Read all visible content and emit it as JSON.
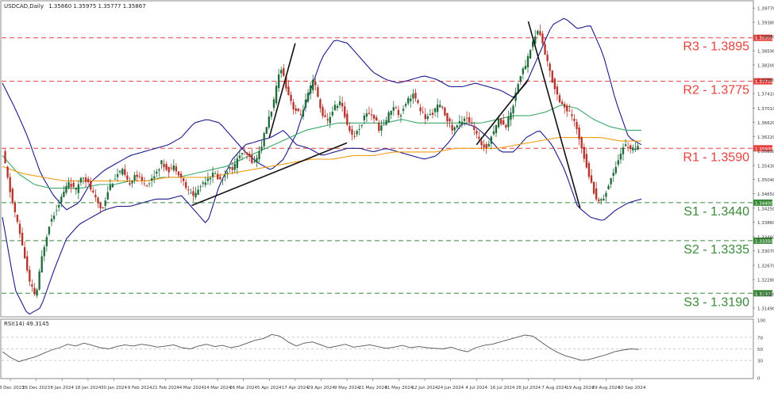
{
  "header": {
    "symbol": "USDCAD,Daily",
    "ohlc": "1.35860 1.35975 1.35777 1.35867"
  },
  "rsi_label": "RSI(14) 49.3145",
  "colors": {
    "resistance": "#e8413c",
    "support": "#3a8a3a",
    "bollinger": "#1a1a8c",
    "ma_green": "#3aa86a",
    "ma_orange": "#f39c12",
    "bull": "#1f6b3a",
    "bear": "#b5332a",
    "rsi": "#555555"
  },
  "levels": [
    {
      "name": "R3",
      "label": "R3 - 1.3895",
      "value": 1.3895,
      "tag": "1.38950",
      "type": "resistance"
    },
    {
      "name": "R2",
      "label": "R2 - 1.3775",
      "value": 1.3775,
      "tag": "1.37750",
      "type": "resistance"
    },
    {
      "name": "R1",
      "label": "R1 - 1.3590",
      "value": 1.359,
      "tag": "1.35900",
      "type": "resistance"
    },
    {
      "name": "S1",
      "label": "S1 - 1.3440",
      "value": 1.344,
      "tag": "1.34400",
      "type": "support"
    },
    {
      "name": "S2",
      "label": "S2 - 1.3335",
      "value": 1.3335,
      "tag": "1.33350",
      "type": "support"
    },
    {
      "name": "S3",
      "label": "S3 - 1.3190",
      "value": 1.319,
      "tag": "1.31900",
      "type": "support"
    }
  ],
  "chart_data": {
    "type": "candlestick",
    "ylim": [
      1.3125,
      1.3995
    ],
    "y_ticks": [
      "1.39770",
      "1.39380",
      "1.38990",
      "1.38590",
      "1.38200",
      "1.37800",
      "1.37410",
      "1.37010",
      "1.36620",
      "1.36220",
      "1.35830",
      "1.35430",
      "1.35040",
      "1.34650",
      "1.34250",
      "1.33860",
      "1.33460",
      "1.33070",
      "1.32670",
      "1.32280",
      "1.31880",
      "1.31490"
    ],
    "x_ticks": [
      "13 Dec 2023",
      "26 Dec 2023",
      "8 Jan 2024",
      "18 Jan 2024",
      "30 Jan 2024",
      "9 Feb 2024",
      "21 Feb 2024",
      "4 Mar 2024",
      "14 Mar 2024",
      "26 Mar 2024",
      "5 Apr 2024",
      "17 Apr 2024",
      "29 Apr 2024",
      "9 May 2024",
      "21 May 2024",
      "31 May 2024",
      "12 Jun 2024",
      "24 Jun 2024",
      "4 Jul 2024",
      "16 Jul 2024",
      "26 Jul 2024",
      "7 Aug 2024",
      "19 Aug 2024",
      "29 Aug 2024",
      "10 Sep 2024"
    ],
    "close_path": [
      1.358,
      1.348,
      1.34,
      1.332,
      1.322,
      1.318,
      1.33,
      1.338,
      1.342,
      1.346,
      1.35,
      1.347,
      1.352,
      1.349,
      1.345,
      1.342,
      1.348,
      1.351,
      1.353,
      1.349,
      1.352,
      1.35,
      1.349,
      1.352,
      1.355,
      1.353,
      1.354,
      1.351,
      1.347,
      1.346,
      1.349,
      1.351,
      1.352,
      1.35,
      1.353,
      1.354,
      1.358,
      1.357,
      1.355,
      1.359,
      1.366,
      1.372,
      1.382,
      1.375,
      1.37,
      1.368,
      1.373,
      1.378,
      1.37,
      1.366,
      1.37,
      1.372,
      1.366,
      1.362,
      1.365,
      1.369,
      1.368,
      1.364,
      1.367,
      1.371,
      1.368,
      1.372,
      1.374,
      1.37,
      1.367,
      1.369,
      1.371,
      1.368,
      1.364,
      1.366,
      1.368,
      1.365,
      1.361,
      1.359,
      1.363,
      1.367,
      1.365,
      1.37,
      1.378,
      1.382,
      1.388,
      1.392,
      1.385,
      1.378,
      1.373,
      1.37,
      1.368,
      1.363,
      1.356,
      1.349,
      1.344,
      1.346,
      1.351,
      1.356,
      1.36,
      1.359,
      1.359
    ],
    "upper_band": [
      1.377,
      1.37,
      1.362,
      1.352,
      1.346,
      1.342,
      1.344,
      1.35,
      1.353,
      1.355,
      1.357,
      1.358,
      1.359,
      1.36,
      1.362,
      1.366,
      1.367,
      1.366,
      1.362,
      1.358,
      1.355,
      1.353,
      1.356,
      1.363,
      1.374,
      1.384,
      1.389,
      1.388,
      1.384,
      1.38,
      1.378,
      1.377,
      1.378,
      1.379,
      1.378,
      1.376,
      1.376,
      1.377,
      1.376,
      1.375,
      1.373,
      1.377,
      1.385,
      1.393,
      1.395,
      1.392,
      1.393,
      1.385,
      1.372,
      1.362,
      1.36
    ],
    "lower_band": [
      1.34,
      1.32,
      1.313,
      1.315,
      1.325,
      1.334,
      1.338,
      1.34,
      1.342,
      1.343,
      1.343,
      1.344,
      1.345,
      1.345,
      1.346,
      1.342,
      1.338,
      1.349,
      1.356,
      1.36,
      1.361,
      1.362,
      1.364,
      1.36,
      1.359,
      1.357,
      1.358,
      1.359,
      1.359,
      1.358,
      1.359,
      1.358,
      1.357,
      1.356,
      1.357,
      1.361,
      1.366,
      1.365,
      1.362,
      1.358,
      1.358,
      1.362,
      1.364,
      1.36,
      1.353,
      1.343,
      1.34,
      1.339,
      1.342,
      1.344,
      1.345
    ],
    "ma_green": [
      1.357,
      1.352,
      1.349,
      1.348,
      1.348,
      1.348,
      1.349,
      1.349,
      1.35,
      1.35,
      1.351,
      1.351,
      1.352,
      1.353,
      1.354,
      1.356,
      1.358,
      1.36,
      1.362,
      1.364,
      1.365,
      1.366,
      1.366,
      1.366,
      1.366,
      1.367,
      1.366,
      1.366,
      1.366,
      1.366,
      1.366,
      1.367,
      1.368,
      1.368,
      1.369,
      1.371,
      1.37,
      1.367,
      1.365,
      1.364,
      1.364
    ],
    "ma_orange": [
      1.354,
      1.352,
      1.351,
      1.35,
      1.35,
      1.35,
      1.35,
      1.35,
      1.351,
      1.351,
      1.351,
      1.352,
      1.353,
      1.354,
      1.355,
      1.356,
      1.356,
      1.357,
      1.357,
      1.358,
      1.358,
      1.358,
      1.359,
      1.359,
      1.359,
      1.36,
      1.361,
      1.362,
      1.362,
      1.362,
      1.361,
      1.361
    ],
    "trendlines": [
      {
        "from": [
          "4 Mar 2024",
          1.3432
        ],
        "to": [
          "9 May 2024",
          1.3605
        ]
      },
      {
        "from": [
          "5 Apr 2024",
          1.362
        ],
        "to": [
          "17 Apr 2024",
          1.388
        ]
      },
      {
        "from": [
          "4 Jul 2024",
          1.36
        ],
        "to": [
          "26 Jul 2024",
          1.378
        ]
      },
      {
        "from": [
          "26 Jul 2024",
          1.394
        ],
        "to": [
          "19 Aug 2024",
          1.3425
        ]
      }
    ],
    "rsi": {
      "label": "RSI(14) 49.3145",
      "ylim": [
        0,
        100
      ],
      "ticks": [
        100,
        70,
        50,
        30,
        0
      ],
      "values": [
        45,
        35,
        28,
        32,
        36,
        42,
        48,
        52,
        58,
        55,
        60,
        56,
        52,
        50,
        54,
        57,
        55,
        58,
        56,
        53,
        55,
        57,
        52,
        50,
        55,
        58,
        54,
        56,
        52,
        55,
        60,
        65,
        68,
        75,
        72,
        62,
        55,
        60,
        62,
        57,
        52,
        55,
        58,
        53,
        55,
        57,
        54,
        51,
        53,
        56,
        52,
        54,
        52,
        51,
        50,
        53,
        48,
        45,
        52,
        56,
        58,
        62,
        66,
        70,
        74,
        72,
        62,
        52,
        44,
        38,
        34,
        30,
        32,
        36,
        40,
        45,
        48,
        50,
        49
      ]
    }
  }
}
